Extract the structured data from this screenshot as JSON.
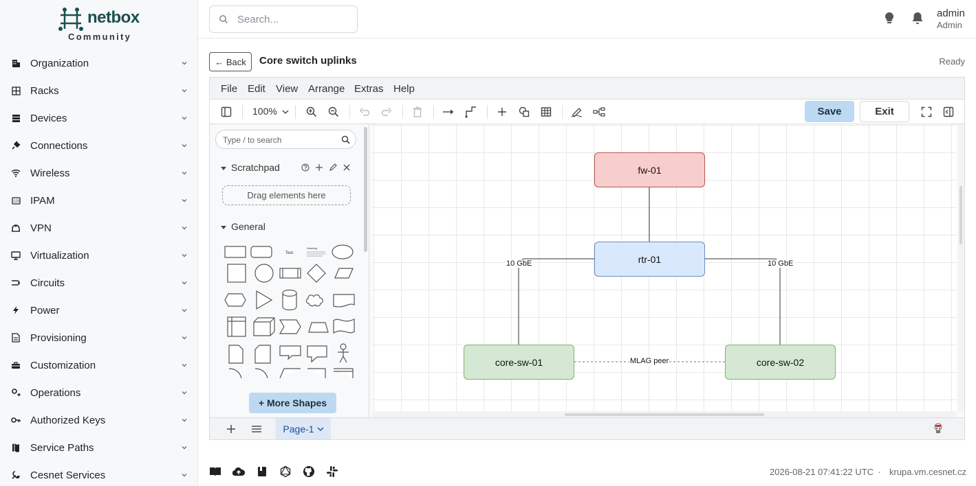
{
  "app": {
    "brand": "netbox",
    "edition": "Community",
    "colors": {
      "brand": "#1a4f4e",
      "accent_button": "#bdd9f2",
      "sidebar_bg": "#f6f8fa"
    }
  },
  "sidebar": {
    "items": [
      {
        "label": "Organization",
        "icon": "building-icon"
      },
      {
        "label": "Racks",
        "icon": "rack-icon"
      },
      {
        "label": "Devices",
        "icon": "server-icon"
      },
      {
        "label": "Connections",
        "icon": "plug-icon"
      },
      {
        "label": "Wireless",
        "icon": "wifi-icon"
      },
      {
        "label": "IPAM",
        "icon": "counter-icon"
      },
      {
        "label": "VPN",
        "icon": "tunnel-icon"
      },
      {
        "label": "Virtualization",
        "icon": "monitor-icon"
      },
      {
        "label": "Circuits",
        "icon": "circuit-icon"
      },
      {
        "label": "Power",
        "icon": "flash-icon"
      },
      {
        "label": "Provisioning",
        "icon": "file-icon"
      },
      {
        "label": "Customization",
        "icon": "toolbox-icon"
      },
      {
        "label": "Operations",
        "icon": "cog-transfer-icon"
      },
      {
        "label": "Authorized Keys",
        "icon": "key-icon"
      },
      {
        "label": "Service Paths",
        "icon": "map-icon"
      },
      {
        "label": "Cesnet Services",
        "icon": "services-icon"
      }
    ]
  },
  "header": {
    "search_placeholder": "Search...",
    "user": {
      "name": "admin",
      "role": "Admin"
    }
  },
  "page": {
    "back_label": "← Back",
    "title": "Core switch uplinks",
    "status": "Ready"
  },
  "editor": {
    "menus": [
      "File",
      "Edit",
      "View",
      "Arrange",
      "Extras",
      "Help"
    ],
    "zoom": "100%",
    "save_label": "Save",
    "exit_label": "Exit",
    "shape_search_placeholder": "Type / to search",
    "scratchpad": {
      "title": "Scratchpad",
      "drop_hint": "Drag elements here"
    },
    "general_title": "General",
    "more_shapes_label": "+ More Shapes",
    "page_tab": "Page-1",
    "shape_text_sample": "Text",
    "shape_heading_sample": "Heading"
  },
  "diagram": {
    "nodes": [
      {
        "id": "fw-01",
        "label": "fw-01",
        "fill": "#f8cecc",
        "stroke": "#b85450"
      },
      {
        "id": "rtr-01",
        "label": "rtr-01",
        "fill": "#dae8fc",
        "stroke": "#6c8ebf"
      },
      {
        "id": "core-sw-01",
        "label": "core-sw-01",
        "fill": "#d5e8d4",
        "stroke": "#82b366"
      },
      {
        "id": "core-sw-02",
        "label": "core-sw-02",
        "fill": "#d5e8d4",
        "stroke": "#82b366"
      }
    ],
    "edges": [
      {
        "from": "fw-01",
        "to": "rtr-01",
        "label": ""
      },
      {
        "from": "rtr-01",
        "to": "core-sw-01",
        "label": "10 GbE"
      },
      {
        "from": "rtr-01",
        "to": "core-sw-02",
        "label": "10 GbE"
      },
      {
        "from": "core-sw-01",
        "to": "core-sw-02",
        "label": "MLAG peer",
        "style": "dashed"
      }
    ]
  },
  "footer": {
    "timestamp": "2026-08-21 07:41:22 UTC",
    "separator": "·",
    "host": "krupa.vm.cesnet.cz"
  }
}
